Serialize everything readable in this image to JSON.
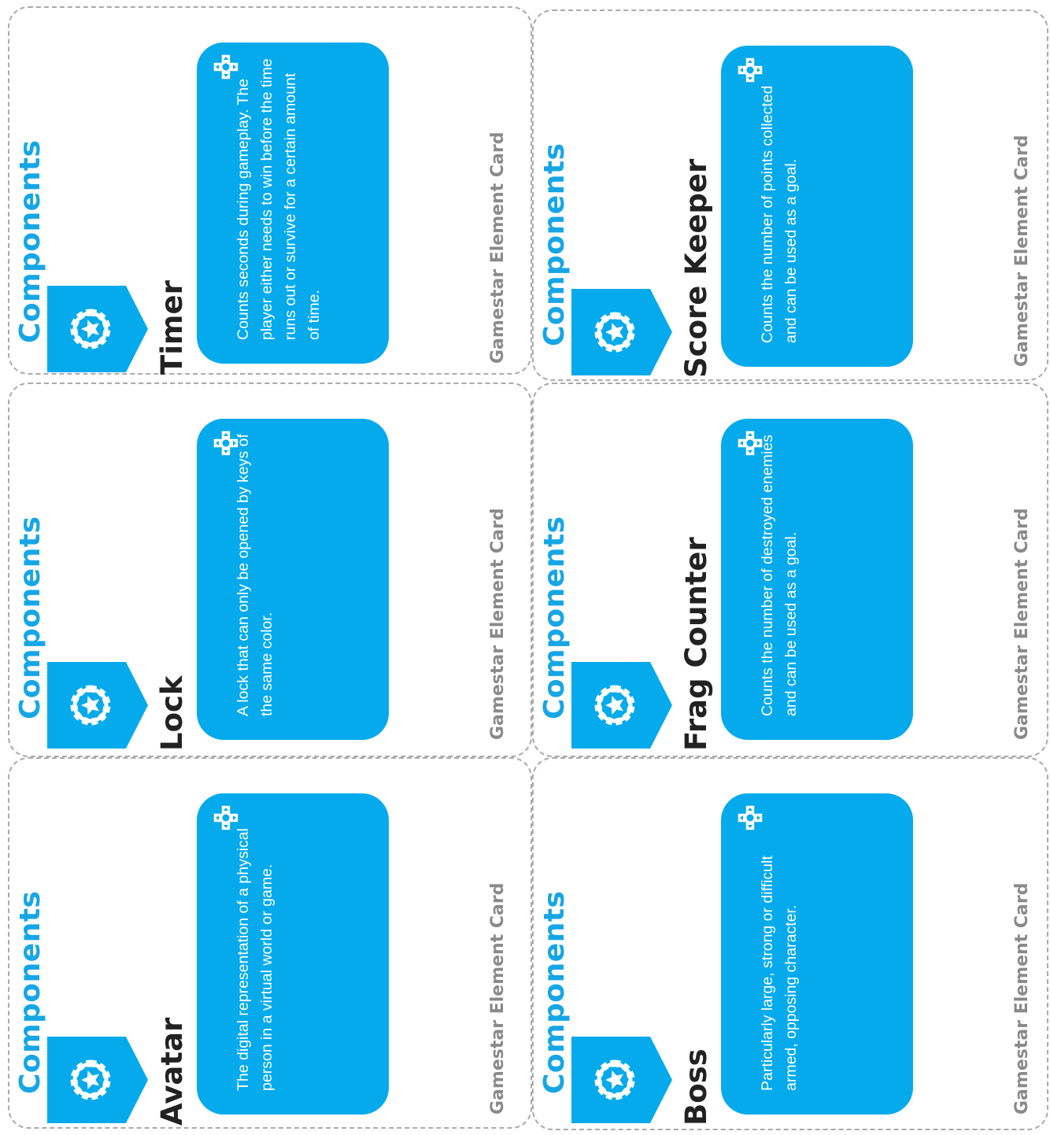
{
  "sheet": {
    "accent_color": "#04aaec",
    "category_color": "#16a6e6",
    "cards": [
      {
        "category": "Components",
        "category_icon": "gear-star-icon",
        "title": "Timer",
        "description": "Counts seconds during gameplay. The player either needs to win before the time runs out or survive for a certain amount of time.",
        "badge_icon": "dpad-icon",
        "footer": "Gamestar Element Card"
      },
      {
        "category": "Components",
        "category_icon": "gear-star-icon",
        "title": "Lock",
        "description": "A lock that can only be opened by keys of the same color.",
        "badge_icon": "dpad-icon",
        "footer": "Gamestar Element Card"
      },
      {
        "category": "Components",
        "category_icon": "gear-star-icon",
        "title": "Avatar",
        "description": "The digital representation of a physical person in a virtual world or game.",
        "badge_icon": "dpad-icon",
        "footer": "Gamestar Element Card"
      },
      {
        "category": "Components",
        "category_icon": "gear-star-icon",
        "title": "Score Keeper",
        "description": "Counts the number of points collected and can be used as a goal.",
        "badge_icon": "dpad-icon",
        "footer": "Gamestar Element Card"
      },
      {
        "category": "Components",
        "category_icon": "gear-star-icon",
        "title": "Frag Counter",
        "description": "Counts the number of destroyed enemies and can be used as a goal.",
        "badge_icon": "dpad-icon",
        "footer": "Gamestar Element Card"
      },
      {
        "category": "Components",
        "category_icon": "gear-star-icon",
        "title": "Boss",
        "description": "Particularly large, strong or difficult armed, opposing character.",
        "badge_icon": "dpad-icon",
        "footer": "Gamestar Element Card"
      }
    ]
  }
}
